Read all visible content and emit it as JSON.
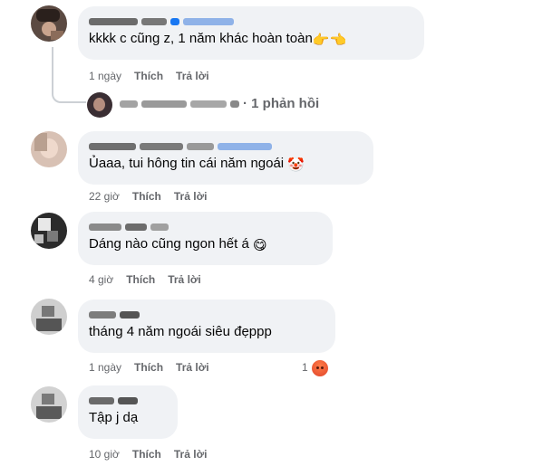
{
  "comments": [
    {
      "name": "",
      "text": "kkkk c cũng z, 1 năm khác hoàn toàn",
      "emoji": "👉👈",
      "time": "1 ngày",
      "like_label": "Thích",
      "reply_label": "Trả lời",
      "reply_summary": "· 1 phản hồi"
    },
    {
      "name": "",
      "text": "Ủaaa, tui hông tin cái năm ngoái",
      "emoji": "🤡",
      "time": "22 giờ",
      "like_label": "Thích",
      "reply_label": "Trả lời"
    },
    {
      "name": "",
      "text": "Dáng nào cũng ngon hết á",
      "emoji": "😋",
      "time": "4 giờ",
      "like_label": "Thích",
      "reply_label": "Trả lời"
    },
    {
      "name": "",
      "text": "tháng 4 năm ngoái siêu đẹppp",
      "emoji": "",
      "time": "1 ngày",
      "like_label": "Thích",
      "reply_label": "Trả lời",
      "reaction_count": "1",
      "reaction_icon": "angry-reaction"
    },
    {
      "name": "",
      "text": "Tập j dạ",
      "emoji": "",
      "time": "10 giờ",
      "like_label": "Thích",
      "reply_label": "Trả lời"
    }
  ],
  "colors": {
    "bubble": "#f0f2f5",
    "meta": "#65676b",
    "text": "#050505",
    "link_blur": "#1877f2"
  }
}
